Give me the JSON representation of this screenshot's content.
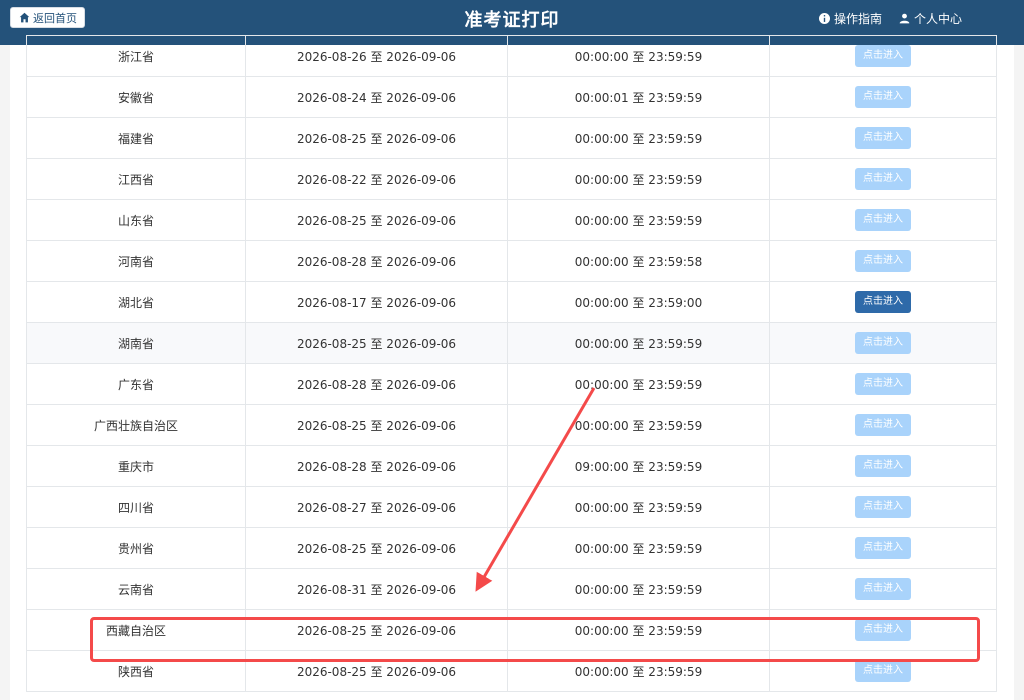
{
  "header": {
    "back_label": "返回首页",
    "title": "准考证打印",
    "guide_label": "操作指南",
    "account_label": "个人中心",
    "bar_color": "#24527a"
  },
  "table": {
    "rows": [
      {
        "region": "浙江省",
        "dates": "2026-08-26 至 2026-09-06",
        "times": "00:00:00 至 23:59:59",
        "action": "点击进入",
        "active": false
      },
      {
        "region": "安徽省",
        "dates": "2026-08-24 至 2026-09-06",
        "times": "00:00:01 至 23:59:59",
        "action": "点击进入",
        "active": false
      },
      {
        "region": "福建省",
        "dates": "2026-08-25 至 2026-09-06",
        "times": "00:00:00 至 23:59:59",
        "action": "点击进入",
        "active": false
      },
      {
        "region": "江西省",
        "dates": "2026-08-22 至 2026-09-06",
        "times": "00:00:00 至 23:59:59",
        "action": "点击进入",
        "active": false
      },
      {
        "region": "山东省",
        "dates": "2026-08-25 至 2026-09-06",
        "times": "00:00:00 至 23:59:59",
        "action": "点击进入",
        "active": false
      },
      {
        "region": "河南省",
        "dates": "2026-08-28 至 2026-09-06",
        "times": "00:00:00 至 23:59:58",
        "action": "点击进入",
        "active": false
      },
      {
        "region": "湖北省",
        "dates": "2026-08-17 至 2026-09-06",
        "times": "00:00:00 至 23:59:00",
        "action": "点击进入",
        "active": true
      },
      {
        "region": "湖南省",
        "dates": "2026-08-25 至 2026-09-06",
        "times": "00:00:00 至 23:59:59",
        "action": "点击进入",
        "active": false
      },
      {
        "region": "广东省",
        "dates": "2026-08-28 至 2026-09-06",
        "times": "00:00:00 至 23:59:59",
        "action": "点击进入",
        "active": false
      },
      {
        "region": "广西壮族自治区",
        "dates": "2026-08-25 至 2026-09-06",
        "times": "00:00:00 至 23:59:59",
        "action": "点击进入",
        "active": false
      },
      {
        "region": "重庆市",
        "dates": "2026-08-28 至 2026-09-06",
        "times": "09:00:00 至 23:59:59",
        "action": "点击进入",
        "active": false
      },
      {
        "region": "四川省",
        "dates": "2026-08-27 至 2026-09-06",
        "times": "00:00:00 至 23:59:59",
        "action": "点击进入",
        "active": false
      },
      {
        "region": "贵州省",
        "dates": "2026-08-25 至 2026-09-06",
        "times": "00:00:00 至 23:59:59",
        "action": "点击进入",
        "active": false
      },
      {
        "region": "云南省",
        "dates": "2026-08-31 至 2026-09-06",
        "times": "00:00:00 至 23:59:59",
        "action": "点击进入",
        "active": false
      },
      {
        "region": "西藏自治区",
        "dates": "2026-08-25 至 2026-09-06",
        "times": "00:00:00 至 23:59:59",
        "action": "点击进入",
        "active": false
      },
      {
        "region": "陕西省",
        "dates": "2026-08-25 至 2026-09-06",
        "times": "00:00:00 至 23:59:59",
        "action": "点击进入",
        "active": false
      }
    ]
  },
  "annotation": {
    "highlight_color": "#f44a4a"
  }
}
